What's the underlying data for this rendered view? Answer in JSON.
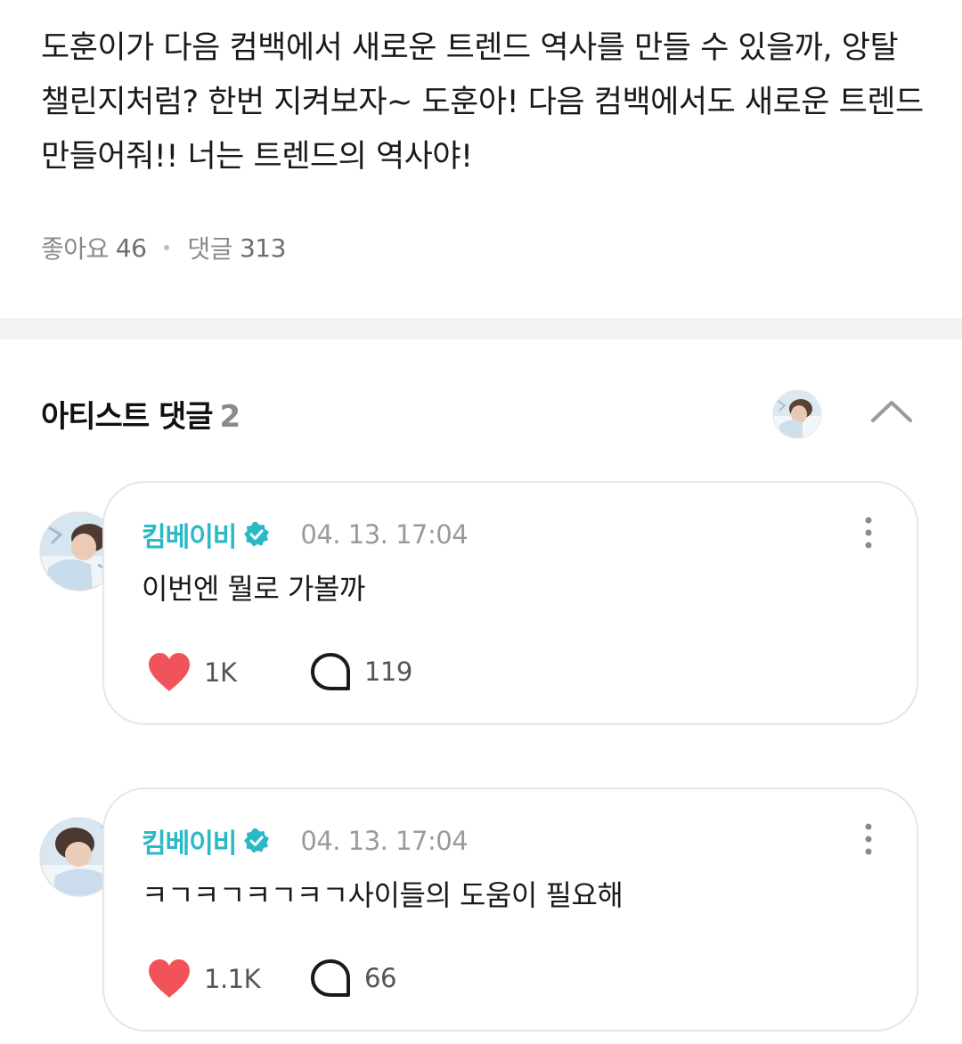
{
  "post": {
    "body": "도훈이가 다음 컴백에서 새로운 트렌드 역사를 만들 수 있을까, 앙탈 챌린지처럼? 한번 지켜보자~ 도훈아! 다음 컴백에서도 새로운 트렌드 만들어줘!! 너는 트렌드의 역사야!",
    "likes_label": "좋아요",
    "likes": "46",
    "comments_label": "댓글",
    "comments": "313"
  },
  "artist_comments": {
    "title": "아티스트 댓글",
    "count": "2"
  },
  "comments": [
    {
      "author": "킴베이비",
      "time": "04. 13. 17:04",
      "text": "이번엔 뭘로 가볼까",
      "likes": "1K",
      "replies": "119"
    },
    {
      "author": "킴베이비",
      "time": "04. 13. 17:04",
      "text": "ㅋㄱㅋㄱㅋㄱㅋㄱ사이들의 도움이 필요해",
      "likes": "1.1K",
      "replies": "66"
    }
  ],
  "colors": {
    "accent": "#2bb8c7",
    "heart": "#f0545a",
    "muted": "#9a9a9a",
    "divider": "#f2f2f2"
  },
  "icons": [
    "verified-badge-icon",
    "more-vertical-icon",
    "heart-icon",
    "reply-bubble-icon",
    "chevron-up-icon",
    "avatar"
  ]
}
